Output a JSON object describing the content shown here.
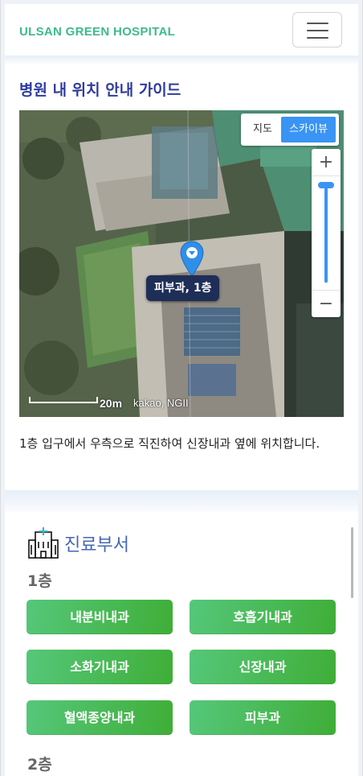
{
  "header": {
    "brand": "ULSAN GREEN HOSPITAL",
    "menu_icon": "hamburger-menu-icon"
  },
  "location": {
    "title": "병원 내 위치 안내 가이드",
    "map": {
      "type_options": [
        "지도",
        "스카이뷰"
      ],
      "active_type": "스카이뷰",
      "zoom_in_label": "+",
      "zoom_out_label": "−",
      "zoom_level": 0.96,
      "marker_label": "피부과, 1층",
      "scale_label": "20m",
      "copyright": "kakao, NGII",
      "accent_color": "#3a94f4"
    },
    "description": "1층 입구에서 우측으로 직진하여 신장내과 옆에 위치합니다."
  },
  "departments": {
    "title": "진료부서",
    "icon": "hospital-building-icon",
    "floors": [
      {
        "label": "1층",
        "items": [
          "내분비내과",
          "호흡기내과",
          "소화기내과",
          "신장내과",
          "혈액종양내과",
          "피부과"
        ]
      },
      {
        "label": "2층",
        "items": []
      }
    ],
    "button_color": "#4dbb5a"
  }
}
